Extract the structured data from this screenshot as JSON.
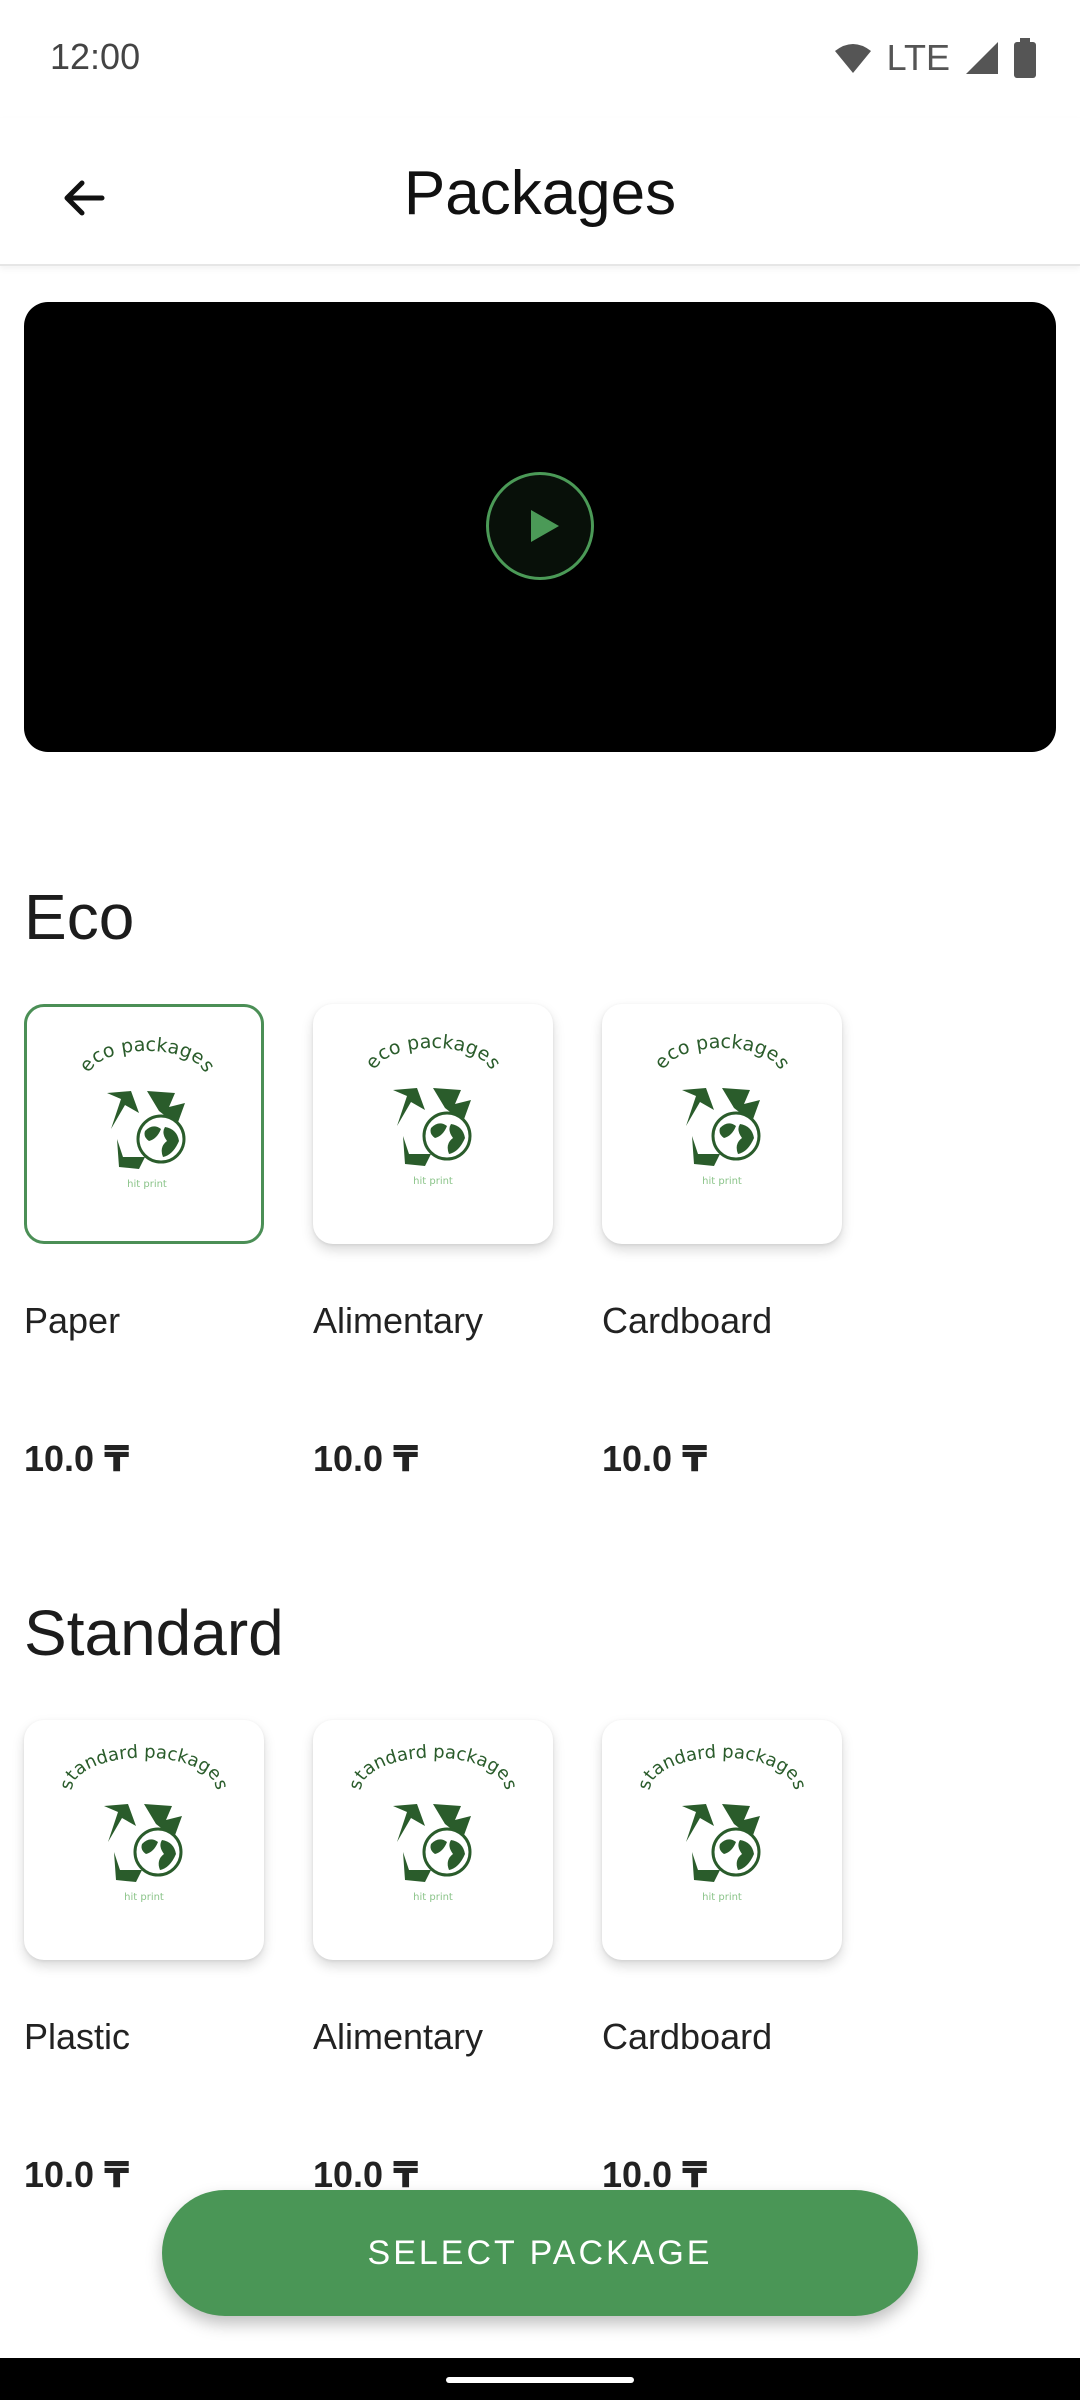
{
  "status_bar": {
    "time": "12:00",
    "network": "LTE",
    "icons": [
      "wifi-icon",
      "cellular-signal-icon",
      "battery-icon"
    ]
  },
  "app_bar": {
    "title": "Packages",
    "back_icon": "arrow-back-icon"
  },
  "video": {
    "play_icon": "play-icon"
  },
  "logo": {
    "eco_text": "eco packages",
    "standard_text": "standard packages",
    "subtext": "hit print"
  },
  "sections": [
    {
      "title": "Eco",
      "items": [
        {
          "label": "Paper",
          "price": "10.0 ₸",
          "selected": true
        },
        {
          "label": "Alimentary",
          "price": "10.0 ₸",
          "selected": false
        },
        {
          "label": "Cardboard",
          "price": "10.0 ₸",
          "selected": false
        }
      ]
    },
    {
      "title": "Standard",
      "items": [
        {
          "label": "Plastic",
          "price": "10.0 ₸",
          "selected": false
        },
        {
          "label": "Alimentary",
          "price": "10.0 ₸",
          "selected": false
        },
        {
          "label": "Cardboard",
          "price": "10.0 ₸",
          "selected": false
        }
      ]
    }
  ],
  "button": {
    "label": "SELECT PACKAGE"
  },
  "colors": {
    "accent": "#4a9656",
    "logo_dark": "#2a5c2b",
    "logo_light": "#8bc48a",
    "video_bg": "#000000"
  }
}
